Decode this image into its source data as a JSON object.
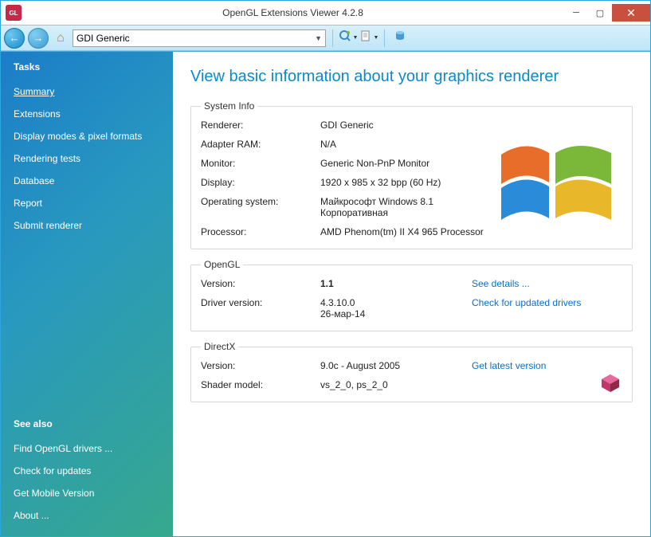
{
  "window": {
    "title": "OpenGL Extensions Viewer 4.2.8"
  },
  "toolbar": {
    "dropdown_value": "GDI Generic"
  },
  "sidebar": {
    "tasks_header": "Tasks",
    "tasks": [
      "Summary",
      "Extensions",
      "Display modes & pixel formats",
      "Rendering tests",
      "Database",
      "Report",
      "Submit renderer"
    ],
    "see_also_header": "See also",
    "see_also": [
      "Find OpenGL drivers ...",
      "Check for updates",
      "Get Mobile Version",
      "About ..."
    ]
  },
  "content": {
    "heading": "View basic information about your graphics renderer",
    "system_info": {
      "legend": "System Info",
      "rows": {
        "renderer_label": "Renderer:",
        "renderer_value": "GDI Generic",
        "ram_label": "Adapter RAM:",
        "ram_value": "N/A",
        "monitor_label": "Monitor:",
        "monitor_value": "Generic Non-PnP Monitor",
        "display_label": "Display:",
        "display_value": "1920 x 985 x 32 bpp (60 Hz)",
        "os_label": "Operating system:",
        "os_value": "Майкрософт Windows 8.1 Корпоративная",
        "cpu_label": "Processor:",
        "cpu_value": "AMD Phenom(tm) II X4 965 Processor"
      }
    },
    "opengl": {
      "legend": "OpenGL",
      "version_label": "Version:",
      "version_value": "1.1",
      "details_link": "See details ...",
      "driver_label": "Driver version:",
      "driver_value": "4.3.10.0\n26-мар-14",
      "update_link": "Check for updated drivers"
    },
    "directx": {
      "legend": "DirectX",
      "version_label": "Version:",
      "version_value": "9.0c - August 2005",
      "latest_link": "Get latest version",
      "shader_label": "Shader model:",
      "shader_value": "vs_2_0, ps_2_0"
    }
  }
}
